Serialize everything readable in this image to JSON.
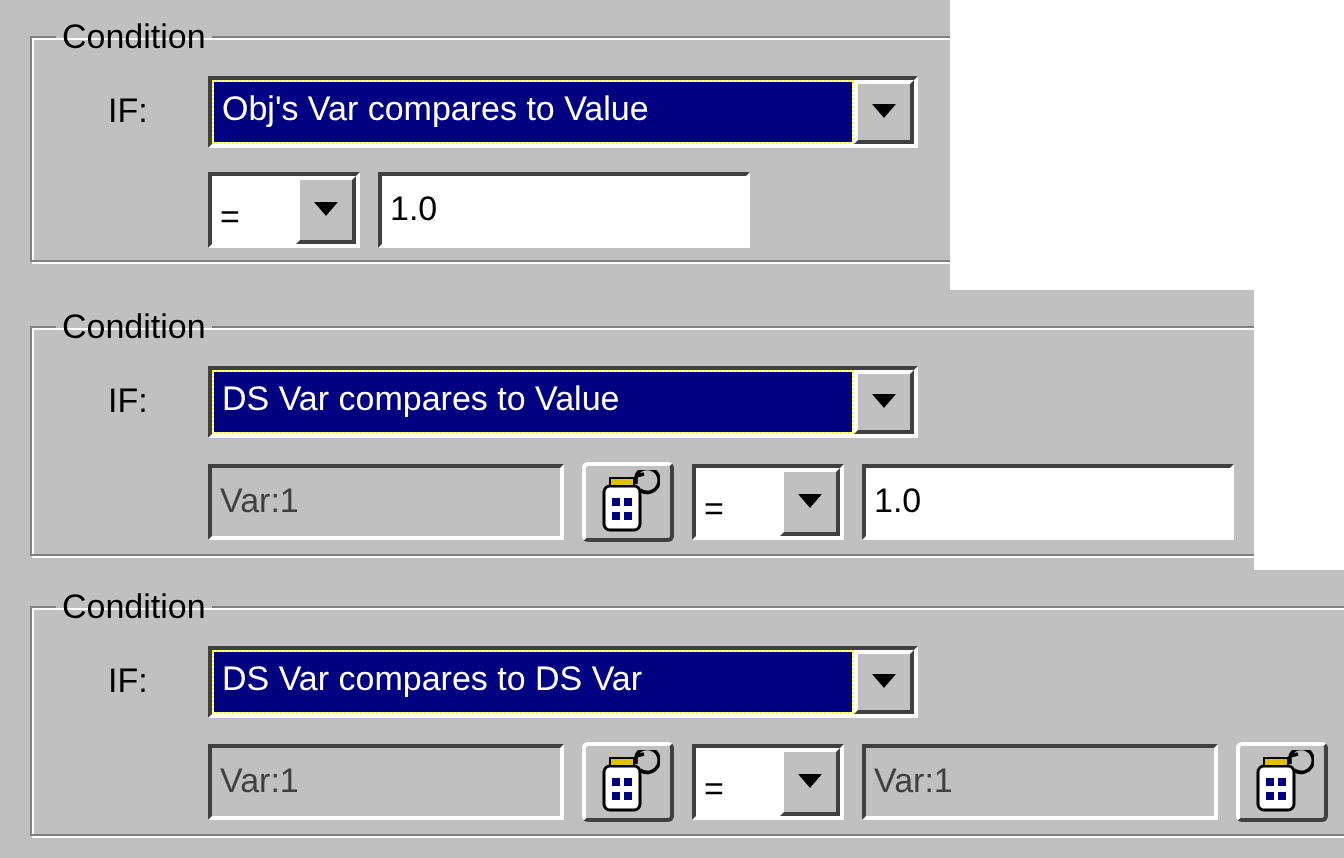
{
  "conditions": [
    {
      "title": "Condition",
      "if_label": "IF:",
      "selection": {
        "text": "Obj's Var compares to Value",
        "highlighted": true
      },
      "operands": [
        {
          "kind": "operator",
          "value": "="
        },
        {
          "kind": "value",
          "value": "1.0"
        }
      ]
    },
    {
      "title": "Condition",
      "if_label": "IF:",
      "selection": {
        "text": "DS Var compares to Value",
        "highlighted": true
      },
      "operands": [
        {
          "kind": "variable",
          "value": "Var:1"
        },
        {
          "kind": "operator",
          "value": "="
        },
        {
          "kind": "value",
          "value": "1.0"
        }
      ]
    },
    {
      "title": "Condition",
      "if_label": "IF:",
      "selection": {
        "text": "DS Var compares to DS Var",
        "highlighted": true
      },
      "operands": [
        {
          "kind": "variable",
          "value": "Var:1"
        },
        {
          "kind": "operator",
          "value": "="
        },
        {
          "kind": "variable",
          "value": "Var:1"
        }
      ]
    }
  ]
}
